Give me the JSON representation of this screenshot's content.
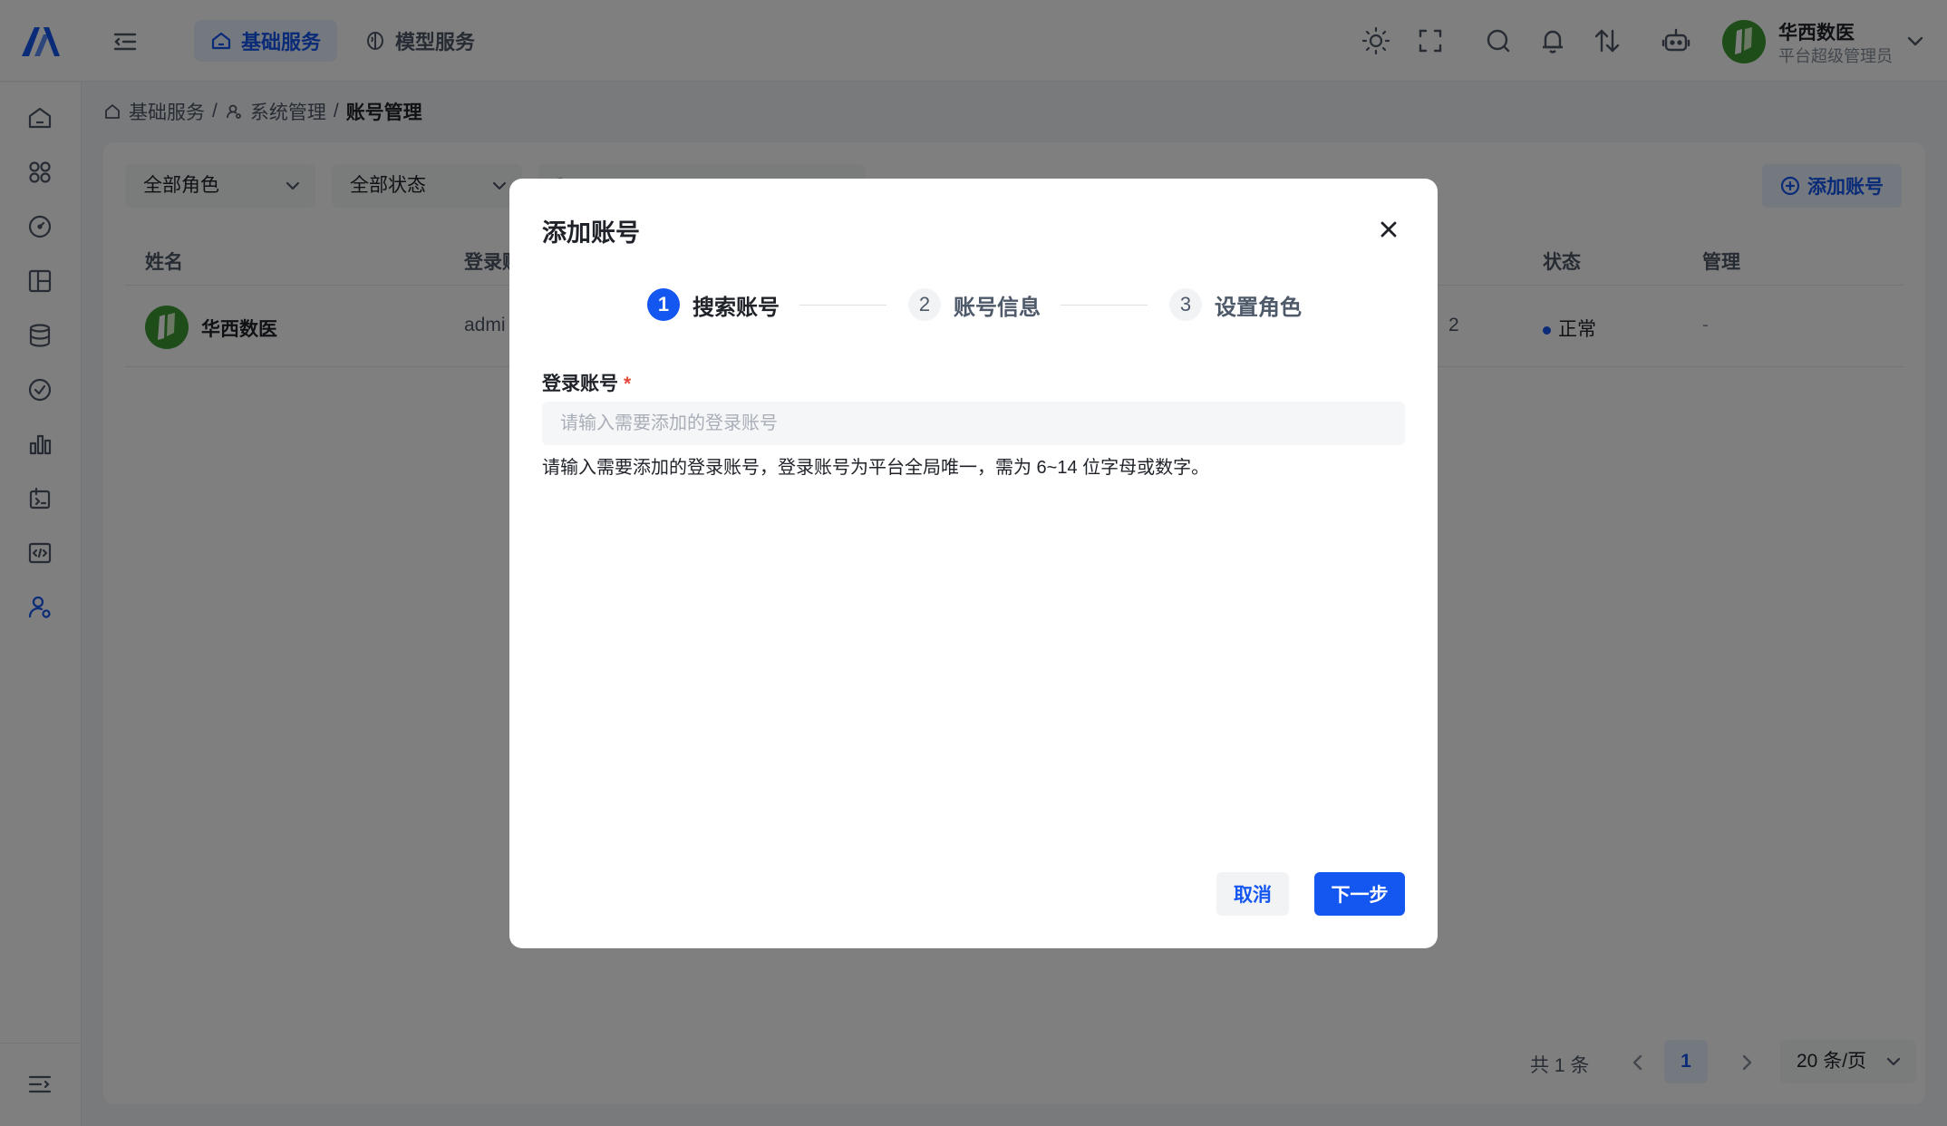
{
  "header": {
    "tabs": [
      {
        "label": "基础服务",
        "icon": "home-icon",
        "active": true
      },
      {
        "label": "模型服务",
        "icon": "brain-icon",
        "active": false
      }
    ],
    "user": {
      "name": "华西数医",
      "role": "平台超级管理员"
    }
  },
  "breadcrumb": {
    "items": [
      "基础服务",
      "系统管理",
      "账号管理"
    ],
    "separator": "/"
  },
  "filters": {
    "role_select": "全部角色",
    "status_select": "全部状态",
    "add_button": "添加账号"
  },
  "table": {
    "columns": [
      "姓名",
      "登录账",
      "状态",
      "管理"
    ],
    "rows": [
      {
        "name": "华西数医",
        "login": "admi",
        "created_partial": "2",
        "status": "正常",
        "manage": "-"
      }
    ]
  },
  "pagination": {
    "total": "共 1 条",
    "current_page": "1",
    "page_size": "20 条/页"
  },
  "modal": {
    "title": "添加账号",
    "steps": [
      {
        "number": "1",
        "label": "搜索账号"
      },
      {
        "number": "2",
        "label": "账号信息"
      },
      {
        "number": "3",
        "label": "设置角色"
      }
    ],
    "active_step": 1,
    "field": {
      "label": "登录账号",
      "required_mark": "*",
      "value": "",
      "placeholder": "请输入需要添加的登录账号",
      "help": "请输入需要添加的登录账号，登录账号为平台全局唯一，需为 6~14 位字母或数字。"
    },
    "cancel_label": "取消",
    "next_label": "下一步"
  },
  "colors": {
    "primary": "#1456f0",
    "primary_light": "#e8f0ff",
    "avatar_green": "#3d9b35",
    "required_red": "#e5483a"
  }
}
